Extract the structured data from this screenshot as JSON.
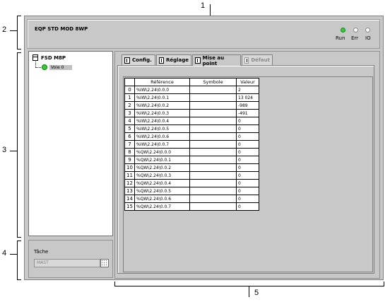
{
  "callouts": {
    "n1": "1",
    "n2": "2",
    "n3": "3",
    "n4": "4",
    "n5": "5"
  },
  "header": {
    "title": "EQP STD MOD 8WP",
    "leds": [
      {
        "label": "Run",
        "color": "#2fd12f"
      },
      {
        "label": "Err",
        "color": "#ffffff"
      },
      {
        "label": "IO",
        "color": "#ffffff"
      }
    ]
  },
  "tree": {
    "root_label": "FSD M8P",
    "child_label": "Voie 0"
  },
  "task": {
    "label": "Tâche",
    "value": "MAST"
  },
  "tabs": [
    {
      "label": "Config.",
      "icon": "config-icon"
    },
    {
      "label": "Réglage",
      "icon": "adjust-icon"
    },
    {
      "label": "Mise au point",
      "icon": "debug-icon"
    },
    {
      "label": "Défaut",
      "icon": "fault-icon"
    }
  ],
  "table": {
    "columns": [
      "Référence",
      "Symbole",
      "Valeur"
    ],
    "rows": [
      {
        "index": "0",
        "reference": "%IW\\2.24\\0.0.0",
        "symbol": "",
        "value": "2"
      },
      {
        "index": "1",
        "reference": "%IW\\2.24\\0.0.1",
        "symbol": "",
        "value": "13 024"
      },
      {
        "index": "2",
        "reference": "%IW\\2.24\\0.0.2",
        "symbol": "",
        "value": "-989"
      },
      {
        "index": "3",
        "reference": "%IW\\2.24\\0.0.3",
        "symbol": "",
        "value": "-491"
      },
      {
        "index": "4",
        "reference": "%IW\\2.24\\0.0.4",
        "symbol": "",
        "value": "0"
      },
      {
        "index": "5",
        "reference": "%IW\\2.24\\0.0.5",
        "symbol": "",
        "value": "0"
      },
      {
        "index": "6",
        "reference": "%IW\\2.24\\0.0.6",
        "symbol": "",
        "value": "0"
      },
      {
        "index": "7",
        "reference": "%IW\\2.24\\0.0.7",
        "symbol": "",
        "value": "0"
      },
      {
        "index": "8",
        "reference": "%QW\\2.24\\0.0.0",
        "symbol": "",
        "value": "0"
      },
      {
        "index": "9",
        "reference": "%QW\\2.24\\0.0.1",
        "symbol": "",
        "value": "0"
      },
      {
        "index": "10",
        "reference": "%QW\\2.24\\0.0.2",
        "symbol": "",
        "value": "0"
      },
      {
        "index": "11",
        "reference": "%QW\\2.24\\0.0.3",
        "symbol": "",
        "value": "0"
      },
      {
        "index": "12",
        "reference": "%QW\\2.24\\0.0.4",
        "symbol": "",
        "value": "0"
      },
      {
        "index": "13",
        "reference": "%QW\\2.24\\0.0.5",
        "symbol": "",
        "value": "0"
      },
      {
        "index": "14",
        "reference": "%QW\\2.24\\0.0.6",
        "symbol": "",
        "value": "0"
      },
      {
        "index": "15",
        "reference": "%QW\\2.24\\0.0.7",
        "symbol": "",
        "value": "0"
      }
    ]
  }
}
